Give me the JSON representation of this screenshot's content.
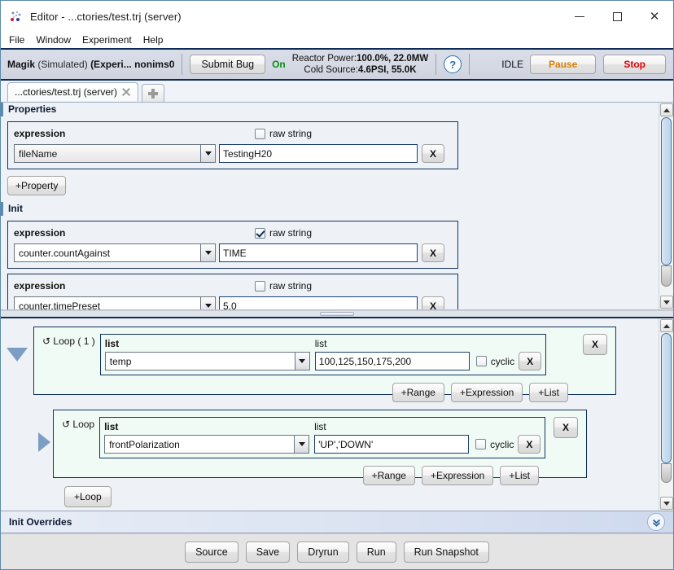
{
  "window": {
    "title": "Editor - ...ctories/test.trj (server)",
    "icon": "app-icon",
    "minimize_label": "—",
    "maximize_label": "□",
    "close_label": "✕"
  },
  "menubar": {
    "items": [
      "File",
      "Window",
      "Experiment",
      "Help"
    ]
  },
  "statusbar": {
    "instrument": "Magik",
    "simulated": "(Simulated)",
    "experiment": "(Experi...",
    "user": "nonims0",
    "submit_bug_label": "Submit Bug",
    "power_state": "On",
    "reactor_power_label": "Reactor Power:",
    "reactor_power_value": "100.0%, 22.0MW",
    "cold_source_label": "Cold Source:",
    "cold_source_value": "4.6PSI, 55.0K",
    "help_icon": "help-icon",
    "run_state": "IDLE",
    "pause_label": "Pause",
    "stop_label": "Stop"
  },
  "tabs": {
    "items": [
      {
        "label": "...ctories/test.trj (server)",
        "close_icon": "close-icon",
        "active": true
      }
    ],
    "add_tab_icon": "plus-icon"
  },
  "properties": {
    "header": "Properties",
    "rows": [
      {
        "expression_label": "expression",
        "raw_string_label": "raw string",
        "raw_string_checked": false,
        "name": "fileName",
        "value": "TestingH20",
        "delete_label": "X"
      }
    ],
    "add_property_label": "+Property"
  },
  "init": {
    "header": "Init",
    "rows": [
      {
        "expression_label": "expression",
        "raw_string_label": "raw string",
        "raw_string_checked": true,
        "name": "counter.countAgainst",
        "value": "TIME",
        "delete_label": "X"
      },
      {
        "expression_label": "expression",
        "raw_string_label": "raw string",
        "raw_string_checked": false,
        "name": "counter.timePreset",
        "value": "5.0",
        "delete_label": "X"
      }
    ]
  },
  "loops": {
    "outer": {
      "tag": "↺ Loop ( 1 )",
      "expand_icon": "triangle-down-icon",
      "list_label": "list",
      "value_label": "list",
      "name": "temp",
      "value": "100,125,150,175,200",
      "cyclic_label": "cyclic",
      "cyclic_checked": false,
      "clear_label": "X",
      "delete_label": "X",
      "add_range_label": "+Range",
      "add_expression_label": "+Expression",
      "add_list_label": "+List"
    },
    "inner": {
      "tag": "↺ Loop",
      "expand_icon": "triangle-right-icon",
      "list_label": "list",
      "value_label": "list",
      "name": "frontPolarization",
      "value": "'UP','DOWN'",
      "cyclic_label": "cyclic",
      "cyclic_checked": false,
      "clear_label": "X",
      "delete_label": "X",
      "add_range_label": "+Range",
      "add_expression_label": "+Expression",
      "add_list_label": "+List"
    },
    "add_loop_label": "+Loop"
  },
  "init_overrides": {
    "label": "Init Overrides",
    "expand_icon": "double-chevron-down-icon"
  },
  "footer": {
    "buttons": [
      "Source",
      "Save",
      "Dryrun",
      "Run",
      "Run Snapshot"
    ]
  },
  "colors": {
    "accent_border": "#0d2b54",
    "on_green": "#0a8c18",
    "pause_orange": "#d98000",
    "stop_red": "#e00000",
    "loop_panel_bg": "#f1fbf6",
    "window_border": "#5b8ba8"
  }
}
